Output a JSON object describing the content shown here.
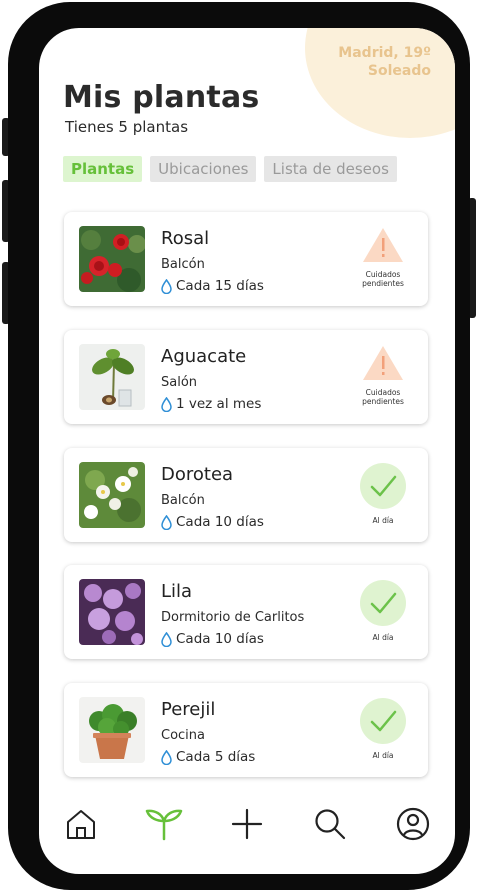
{
  "weather": {
    "location_temp": "Madrid, 19º",
    "condition": "Soleado"
  },
  "header": {
    "title": "Mis plantas",
    "subtitle": "Tienes 5 plantas"
  },
  "tabs": [
    {
      "label": "Plantas",
      "active": true
    },
    {
      "label": "Ubicaciones",
      "active": false
    },
    {
      "label": "Lista de deseos",
      "active": false
    }
  ],
  "plants": [
    {
      "name": "Rosal",
      "location": "Balcón",
      "watering": "Cada 15 días",
      "status": "Cuidados pendientes",
      "status_type": "warning"
    },
    {
      "name": "Aguacate",
      "location": "Salón",
      "watering": "1 vez al mes",
      "status": "Cuidados pendientes",
      "status_type": "warning"
    },
    {
      "name": "Dorotea",
      "location": "Balcón",
      "watering": "Cada 10 días",
      "status": "Al día",
      "status_type": "ok"
    },
    {
      "name": "Lila",
      "location": "Dormitorio de Carlitos",
      "watering": "Cada 10 días",
      "status": "Al día",
      "status_type": "ok"
    },
    {
      "name": "Perejil",
      "location": "Cocina",
      "watering": "Cada 5 días",
      "status": "Al día",
      "status_type": "ok"
    }
  ],
  "nav": [
    {
      "icon": "home-icon",
      "active": false
    },
    {
      "icon": "plant-sprout-icon",
      "active": true
    },
    {
      "icon": "plus-icon",
      "active": false
    },
    {
      "icon": "search-icon",
      "active": false
    },
    {
      "icon": "profile-icon",
      "active": false
    }
  ],
  "colors": {
    "accent": "#66c03a",
    "warning_fill": "#fbd9c4",
    "warning_mark": "#f2a07a",
    "ok_fill": "#dff3d0",
    "ok_mark": "#6cc24a",
    "weather_text": "#e8c48e"
  }
}
